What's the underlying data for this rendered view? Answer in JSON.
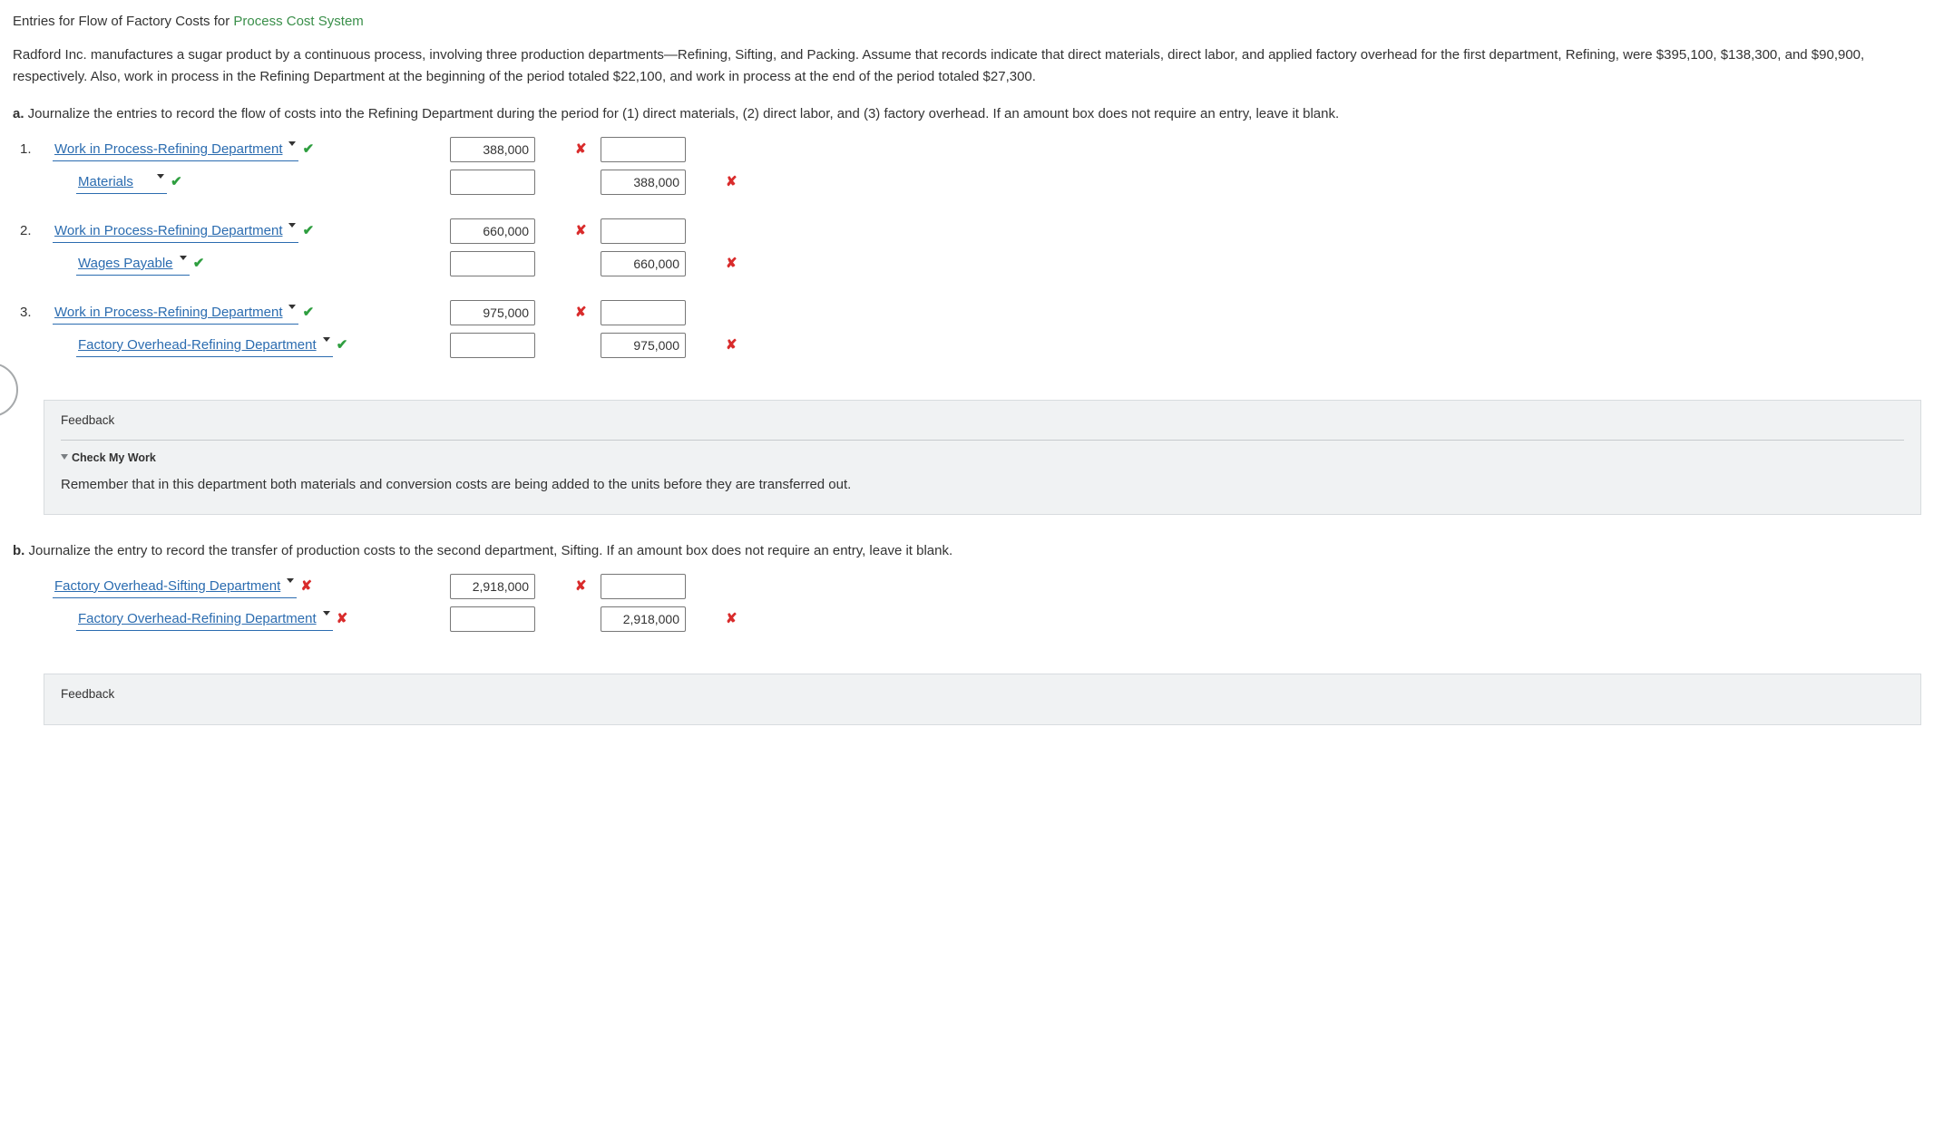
{
  "title_prefix": "Entries for Flow of Factory Costs for ",
  "title_link": "Process Cost System",
  "intro": "Radford Inc. manufactures a sugar product by a continuous process, involving three production departments—Refining, Sifting, and Packing. Assume that records indicate that direct materials, direct labor, and applied factory overhead for the first department, Refining, were $395,100, $138,300, and $90,900, respectively. Also, work in process in the Refining Department at the beginning of the period totaled $22,100, and work in process at the end of the period totaled $27,300.",
  "part_a_label": "a.",
  "part_a_text": "  Journalize the entries to record the flow of costs into the Refining Department during the period for (1) direct materials, (2) direct labor, and (3) factory overhead. If an amount box does not require an entry, leave it blank.",
  "entries_a": [
    {
      "num": "1.",
      "debit": {
        "account": "Work in Process-Refining Department",
        "acct_mark": "ok",
        "debit_val": "388,000",
        "debit_mark": "bad",
        "credit_val": "",
        "credit_mark": ""
      },
      "credit": {
        "account": "Materials",
        "acct_mark": "ok",
        "debit_val": "",
        "debit_mark": "",
        "credit_val": "388,000",
        "credit_mark": "bad"
      }
    },
    {
      "num": "2.",
      "debit": {
        "account": "Work in Process-Refining Department",
        "acct_mark": "ok",
        "debit_val": "660,000",
        "debit_mark": "bad",
        "credit_val": "",
        "credit_mark": ""
      },
      "credit": {
        "account": "Wages Payable",
        "acct_mark": "ok",
        "debit_val": "",
        "debit_mark": "",
        "credit_val": "660,000",
        "credit_mark": "bad"
      }
    },
    {
      "num": "3.",
      "debit": {
        "account": "Work in Process-Refining Department",
        "acct_mark": "ok",
        "debit_val": "975,000",
        "debit_mark": "bad",
        "credit_val": "",
        "credit_mark": ""
      },
      "credit": {
        "account": "Factory Overhead-Refining Department",
        "acct_mark": "ok",
        "debit_val": "",
        "debit_mark": "",
        "credit_val": "975,000",
        "credit_mark": "bad"
      }
    }
  ],
  "feedback_a": {
    "header": "Feedback",
    "sub": "Check My Work",
    "body": "Remember that in this department both materials and conversion costs are being added to the units before they are transferred out."
  },
  "part_b_label": "b.",
  "part_b_text": "  Journalize the entry to record the transfer of production costs to the second department, Sifting. If an amount box does not require an entry, leave it blank.",
  "entries_b": [
    {
      "num": "",
      "debit": {
        "account": "Factory Overhead-Sifting Department",
        "acct_mark": "bad",
        "debit_val": "2,918,000",
        "debit_mark": "bad",
        "credit_val": "",
        "credit_mark": ""
      },
      "credit": {
        "account": "Factory Overhead-Refining Department",
        "acct_mark": "bad",
        "debit_val": "",
        "debit_mark": "",
        "credit_val": "2,918,000",
        "credit_mark": "bad"
      }
    }
  ],
  "feedback_b": {
    "header": "Feedback"
  },
  "marks": {
    "ok": "✔",
    "bad": "✘"
  }
}
